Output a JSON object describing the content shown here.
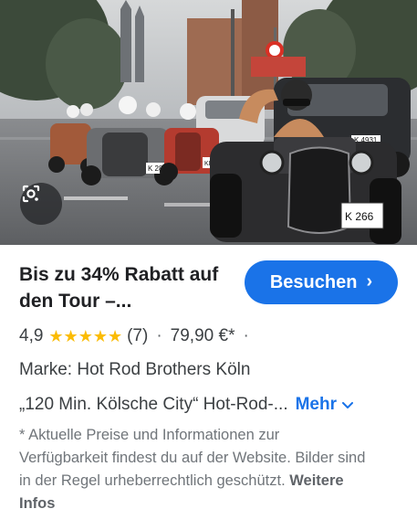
{
  "image": {
    "alt": "Hot Rod Tour Köln",
    "plate_front": "K  266",
    "plate_left": "K 288",
    "plate_mid": "KI 47",
    "plate_car": "K 4931"
  },
  "product": {
    "title": "Bis zu 34% Rabatt auf den Tour –...",
    "visit_label": "Besuchen",
    "rating_value": "4,9",
    "stars": "★★★★★",
    "review_count": "(7)",
    "separator": "·",
    "price": "79,90 €*",
    "trailing_dot": "·",
    "brand": "Marke: Hot Rod Brothers Köln",
    "description": "„120 Min. Kölsche City“ Hot-Rod-...",
    "more_label": "Mehr",
    "disclaimer": "* Aktuelle Preise und Informationen zur Verfügbarkeit findest du auf der Website. Bilder sind in der Regel urheberrechtlich geschützt.",
    "more_info_label": "Weitere Infos"
  },
  "colors": {
    "accent": "#1a73e8",
    "star": "#fbbc04",
    "text_primary": "#202124",
    "text_secondary": "#70757a"
  },
  "icons": {
    "lens": "google-lens-icon",
    "visit_chevron": "chevron-right-icon",
    "more_chevron": "chevron-down-icon"
  }
}
